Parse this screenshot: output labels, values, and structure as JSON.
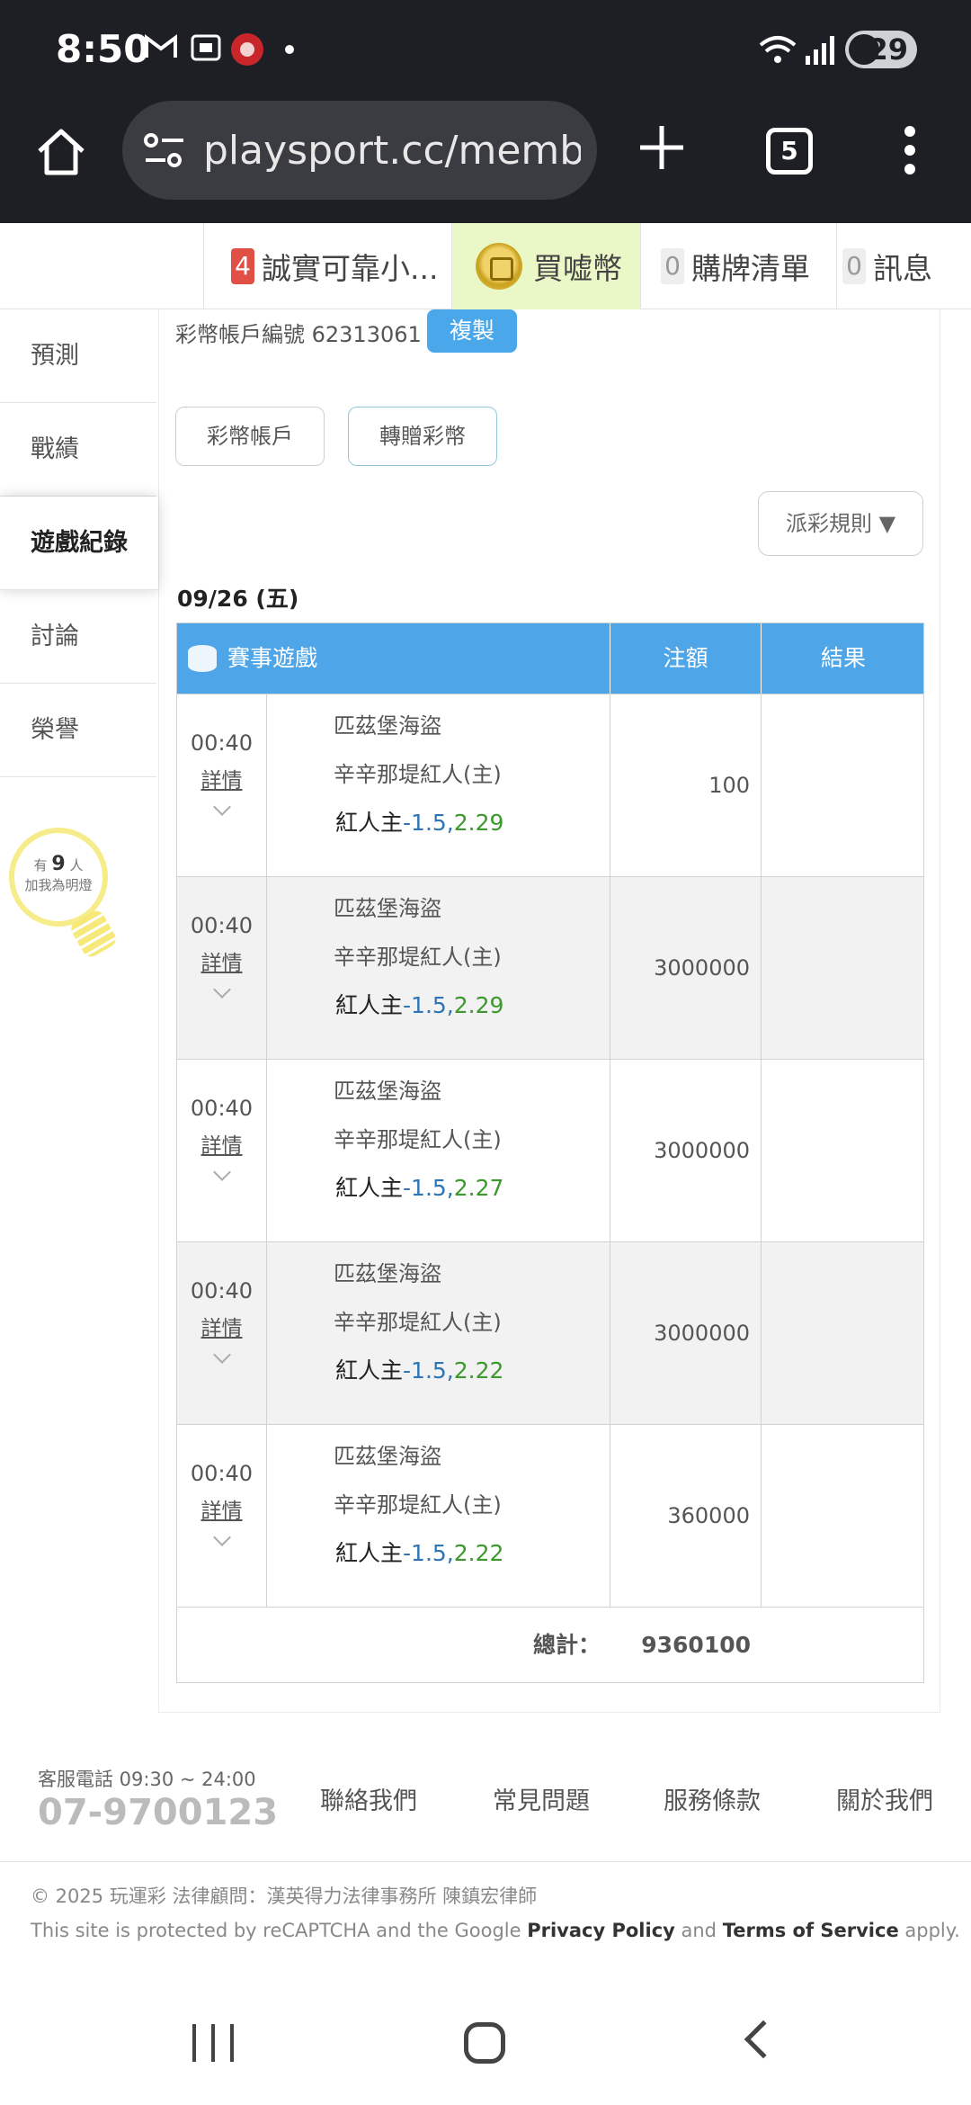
{
  "status": {
    "time": "8:50",
    "battery": "29"
  },
  "browser": {
    "url": "playsport.cc/membe",
    "tab_count": "5"
  },
  "topnav": [
    {
      "badge": "4",
      "label": "誠實可靠小..."
    },
    {
      "label": "買嘘幣"
    },
    {
      "badge": "0",
      "label": "購牌清單"
    },
    {
      "badge": "0",
      "label": "訊息"
    }
  ],
  "sidebar": {
    "items": [
      {
        "label": "預測"
      },
      {
        "label": "戰績"
      },
      {
        "label": "遊戲紀錄"
      },
      {
        "label": "討論"
      },
      {
        "label": "榮譽"
      }
    ],
    "bulb": {
      "prefix": "有",
      "count": "9",
      "suffix": "人",
      "line2": "加我為明燈"
    }
  },
  "account": {
    "label": "彩幣帳戶編號 62313061",
    "copy_label": "複製"
  },
  "buttons": {
    "coin_account": "彩幣帳戶",
    "gift_coin": "轉贈彩幣",
    "rules": "派彩規則 ▼"
  },
  "date": "09/26 (五)",
  "table": {
    "headers": {
      "game": "賽事遊戲",
      "amount": "注額",
      "result": "結果"
    },
    "rows": [
      {
        "time": "00:40",
        "details": "詳情",
        "away": "匹茲堡海盜",
        "home": "辛辛那堤紅人(主)",
        "pick": "紅人主",
        "handicap": "-1.5,",
        "odds": "2.29",
        "amount": "100",
        "result": ""
      },
      {
        "time": "00:40",
        "details": "詳情",
        "away": "匹茲堡海盜",
        "home": "辛辛那堤紅人(主)",
        "pick": "紅人主",
        "handicap": "-1.5,",
        "odds": "2.29",
        "amount": "3000000",
        "result": ""
      },
      {
        "time": "00:40",
        "details": "詳情",
        "away": "匹茲堡海盜",
        "home": "辛辛那堤紅人(主)",
        "pick": "紅人主",
        "handicap": "-1.5,",
        "odds": "2.27",
        "amount": "3000000",
        "result": ""
      },
      {
        "time": "00:40",
        "details": "詳情",
        "away": "匹茲堡海盜",
        "home": "辛辛那堤紅人(主)",
        "pick": "紅人主",
        "handicap": "-1.5,",
        "odds": "2.22",
        "amount": "3000000",
        "result": ""
      },
      {
        "time": "00:40",
        "details": "詳情",
        "away": "匹茲堡海盜",
        "home": "辛辛那堤紅人(主)",
        "pick": "紅人主",
        "handicap": "-1.5,",
        "odds": "2.22",
        "amount": "360000",
        "result": ""
      }
    ],
    "total_label": "總計：",
    "total_value": "9360100"
  },
  "footer": {
    "service_hours": "客服電話 09:30 ~ 24:00",
    "phone": "07-9700123",
    "links": [
      "聯絡我們",
      "常見問題",
      "服務條款",
      "關於我們"
    ],
    "copyright": "© 2025 玩運彩 法律顧問：漢英得力法律事務所 陳鎮宏律師",
    "recaptcha": {
      "pre": "This site is protected by reCAPTCHA and the Google ",
      "privacy": "Privacy Policy",
      "and": " and ",
      "terms": "Terms of Service",
      "post": " apply."
    }
  },
  "colors": {
    "accent": "#4ea6e8",
    "handicap": "#2e75b6",
    "odds": "#3a9a2a",
    "coin_tab_bg": "#eaf7c6",
    "badge_red": "#e05044"
  }
}
